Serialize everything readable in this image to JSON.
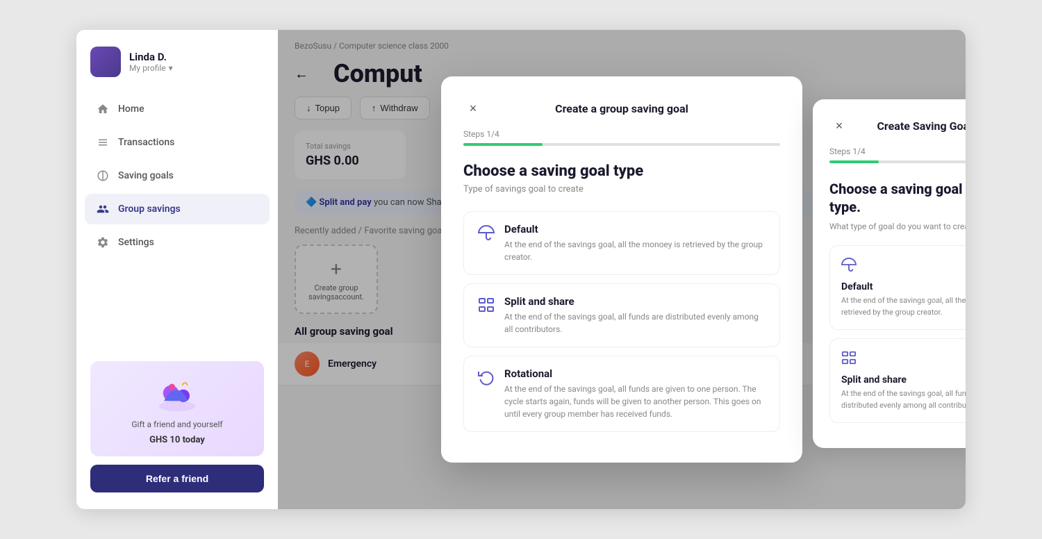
{
  "app": {
    "title": "BezoSusu"
  },
  "sidebar": {
    "user": {
      "name": "Linda D.",
      "profile_label": "My profile"
    },
    "nav": [
      {
        "id": "home",
        "label": "Home",
        "icon": "home"
      },
      {
        "id": "transactions",
        "label": "Transactions",
        "icon": "transactions"
      },
      {
        "id": "saving-goals",
        "label": "Saving goals",
        "icon": "saving"
      },
      {
        "id": "group-savings",
        "label": "Group savings",
        "icon": "group",
        "active": true
      },
      {
        "id": "settings",
        "label": "Settings",
        "icon": "settings"
      }
    ],
    "gift": {
      "text": "Gift a friend and yourself",
      "amount": "GHS 10 today"
    },
    "refer_btn": "Refer a friend"
  },
  "main": {
    "breadcrumb": "BezoSusu / Computer science class 2000",
    "page_title": "Comput",
    "actions": [
      {
        "label": "Topup",
        "dir": "down"
      },
      {
        "label": "Withdraw",
        "dir": "up"
      }
    ],
    "stats": {
      "label": "Total savings",
      "value": "GHS 0.00"
    },
    "banner": {
      "bold_text": "Split and pay",
      "text": " you can now Share"
    },
    "recently_added": "Recently added / Favorite saving goa",
    "all_goals_title": "All group saving goal",
    "goal_list": [
      {
        "name": "Emergency"
      }
    ],
    "create_card": {
      "plus": "+",
      "label": "Create group savingsaccount."
    }
  },
  "modal": {
    "title": "Create a group saving goal",
    "close_icon": "×",
    "steps_label": "Steps 1/4",
    "progress_percent": 25,
    "heading": "Choose a saving goal type",
    "subheading": "Type of savings goal to create",
    "options": [
      {
        "id": "default",
        "name": "Default",
        "desc": "At the end of the savings goal, all the monoey is retrieved by the group creator.",
        "icon": "umbrella"
      },
      {
        "id": "split-share",
        "name": "Split and share",
        "desc": "At the end of the savings goal, all funds are distributed evenly among all contributors.",
        "icon": "split"
      },
      {
        "id": "rotational",
        "name": "Rotational",
        "desc": "At the end of the savings goal, all funds are given to one person. The cycle starts again, funds will be given to another person. This goes on until every group member has received funds.",
        "icon": "rotate"
      }
    ]
  },
  "second_panel": {
    "title": "Create Saving Goals",
    "close_icon": "×",
    "steps_label": "Steps 1/4",
    "progress_percent": 25,
    "heading": "Choose a saving goal account type.",
    "subheading": "What type of goal do you want to create?",
    "options": [
      {
        "id": "default",
        "name": "Default",
        "desc": "At the end of the savings goal, all the monoey is retrieved by the group creator.",
        "icon": "umbrella"
      },
      {
        "id": "split-share",
        "name": "Split and share",
        "desc": "At the end of the savings goal, all funds are distributed evenly among all contributors.",
        "icon": "split"
      }
    ]
  }
}
